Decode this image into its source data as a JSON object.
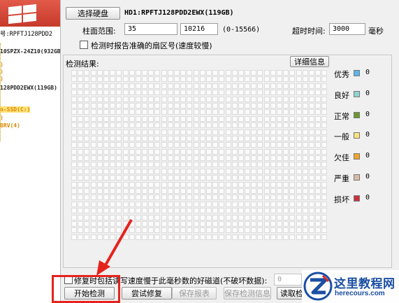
{
  "sidebar": {
    "disk_model_label": "号:RPFTJ128PDD2",
    "tree": [
      {
        "text": "10SPZX-24Z10(932GB",
        "color": "dark"
      },
      {
        "text": ")",
        "color": "orange"
      },
      {
        "text": ")",
        "color": "orange"
      },
      {
        "text": ")",
        "color": "orange"
      },
      {
        "text": "128PDD2EWX(119GB)",
        "color": "dark"
      },
      {
        "text": "n-SSD(C:)",
        "color": "orange",
        "highlight": true
      },
      {
        "text": ")",
        "color": "orange"
      },
      {
        "text": "BRV(4)",
        "color": "orange"
      }
    ]
  },
  "toolbar": {
    "select_disk_label": "选择硬盘",
    "disk_name": "HD1:RPFTJ128PDD2EWX(119GB)"
  },
  "range": {
    "label": "柱面范围:",
    "start": "35",
    "arrow": "-->",
    "end": "10216",
    "hint": "(0-15566)"
  },
  "timeout": {
    "label": "超时时间:",
    "value": "3000",
    "unit": "毫秒"
  },
  "options": {
    "report_sector_label": "检测时报告准确的扇区号(速度较慢)",
    "include_slow_label": "修复时包括读写速度慢于此毫秒数的好磁道(不破坏数据):",
    "slow_ms_value": "0"
  },
  "results": {
    "label": "检测结果:",
    "details_button": "详细信息",
    "grid_rows": 26,
    "grid_cols": 40
  },
  "legend": [
    {
      "label": "优秀",
      "color": "#5bb8e8",
      "count": "0"
    },
    {
      "label": "良好",
      "color": "#8fd3cf",
      "count": "0"
    },
    {
      "label": "正常",
      "color": "#6a9a2e",
      "count": "0"
    },
    {
      "label": "一般",
      "color": "#f7e47e",
      "count": "0"
    },
    {
      "label": "欠佳",
      "color": "#f0a42a",
      "count": "0"
    },
    {
      "label": "严重",
      "color": "#d8bca7",
      "count": "0"
    },
    {
      "label": "损坏",
      "color": "#c8323a",
      "count": "0"
    }
  ],
  "actions": {
    "start_check": "开始检测",
    "try_repair": "尝试修复",
    "save_report": "保存报表",
    "save_check_info": "保存检测信息",
    "read_check": "读取检"
  },
  "annotation_color": "#e5231d",
  "watermark": {
    "title": "这里教程网",
    "url": "herecours.com"
  }
}
